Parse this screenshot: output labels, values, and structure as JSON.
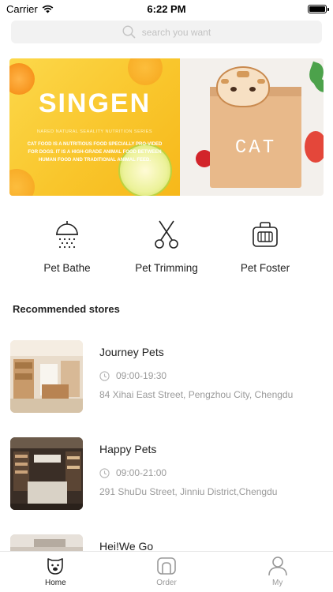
{
  "status_bar": {
    "carrier": "Carrier",
    "time": "6:22 PM",
    "battery_level": 1.0
  },
  "search": {
    "placeholder": "search you want"
  },
  "banner": {
    "title": "SINGEN",
    "subtitle": "NARED NATURAL SEAALITY NUTRITION SERIES",
    "description": "CAT FOOD IS A NUTRITIOUS FOOD SPECIALLY PRO-VIDED FOR DOGS. IT IS A HIGH-GRADE ANIMAL FOOD BETWEEN HUMAN FOOD AND TRADITIONAL ANIMAL FEED.",
    "bag_label": "CAT",
    "colors": {
      "yellow": "#f9c62c",
      "orange": "#f7941d",
      "bag": "#e8b98a"
    }
  },
  "services": [
    {
      "label": "Pet Bathe",
      "icon": "shower-icon"
    },
    {
      "label": "Pet Trimming",
      "icon": "scissors-icon"
    },
    {
      "label": "Pet Foster",
      "icon": "pet-carrier-icon"
    }
  ],
  "section_title": "Recommended stores",
  "stores": [
    {
      "name": "Journey Pets",
      "hours": "09:00-19:30",
      "address": "84 Xihai East Street, Pengzhou City, Chengdu"
    },
    {
      "name": "Happy Pets",
      "hours": "09:00-21:00",
      "address": "291 ShuDu Street, Jinniu District,Chengdu"
    },
    {
      "name": "Hei!We Go",
      "hours": "",
      "address": ""
    }
  ],
  "tab_bar": {
    "tabs": [
      {
        "label": "Home",
        "icon": "dog-face-icon",
        "active": true
      },
      {
        "label": "Order",
        "icon": "shop-icon",
        "active": false
      },
      {
        "label": "My",
        "icon": "person-icon",
        "active": false
      }
    ]
  }
}
